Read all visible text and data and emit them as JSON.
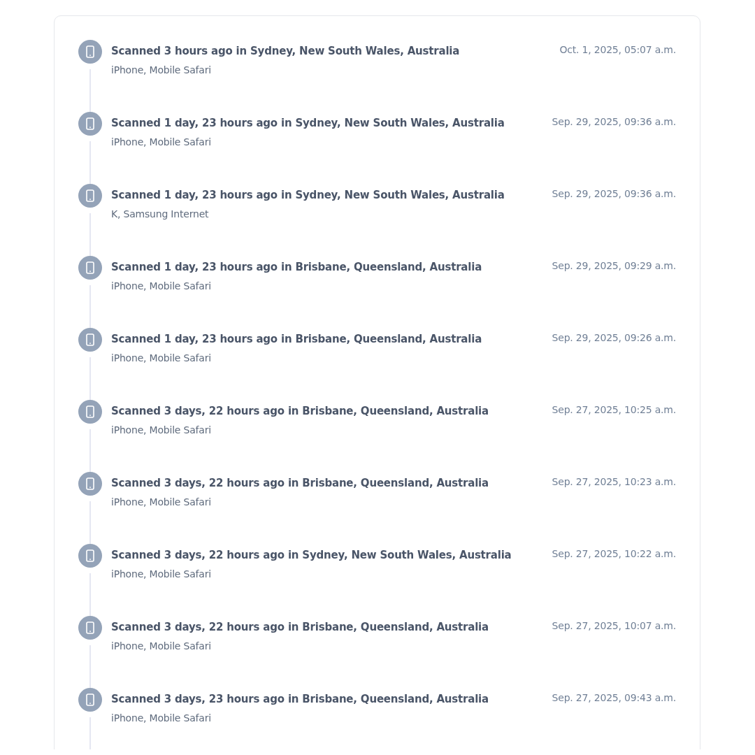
{
  "scans": [
    {
      "title": "Scanned 3 hours ago in Sydney, New South Wales, Australia",
      "device": "iPhone, Mobile Safari",
      "date": "Oct. 1, 2025, 05:07 a.m."
    },
    {
      "title": "Scanned 1 day, 23 hours ago in Sydney, New South Wales, Australia",
      "device": "iPhone, Mobile Safari",
      "date": "Sep. 29, 2025, 09:36 a.m."
    },
    {
      "title": "Scanned 1 day, 23 hours ago in Sydney, New South Wales, Australia",
      "device": "K, Samsung Internet",
      "date": "Sep. 29, 2025, 09:36 a.m."
    },
    {
      "title": "Scanned 1 day, 23 hours ago in Brisbane, Queensland, Australia",
      "device": "iPhone, Mobile Safari",
      "date": "Sep. 29, 2025, 09:29 a.m."
    },
    {
      "title": "Scanned 1 day, 23 hours ago in Brisbane, Queensland, Australia",
      "device": "iPhone, Mobile Safari",
      "date": "Sep. 29, 2025, 09:26 a.m."
    },
    {
      "title": "Scanned 3 days, 22 hours ago in Brisbane, Queensland, Australia",
      "device": "iPhone, Mobile Safari",
      "date": "Sep. 27, 2025, 10:25 a.m."
    },
    {
      "title": "Scanned 3 days, 22 hours ago in Brisbane, Queensland, Australia",
      "device": "iPhone, Mobile Safari",
      "date": "Sep. 27, 2025, 10:23 a.m."
    },
    {
      "title": "Scanned 3 days, 22 hours ago in Sydney, New South Wales, Australia",
      "device": "iPhone, Mobile Safari",
      "date": "Sep. 27, 2025, 10:22 a.m."
    },
    {
      "title": "Scanned 3 days, 22 hours ago in Brisbane, Queensland, Australia",
      "device": "iPhone, Mobile Safari",
      "date": "Sep. 27, 2025, 10:07 a.m."
    },
    {
      "title": "Scanned 3 days, 23 hours ago in Brisbane, Queensland, Australia",
      "device": "iPhone, Mobile Safari",
      "date": "Sep. 27, 2025, 09:43 a.m."
    }
  ]
}
